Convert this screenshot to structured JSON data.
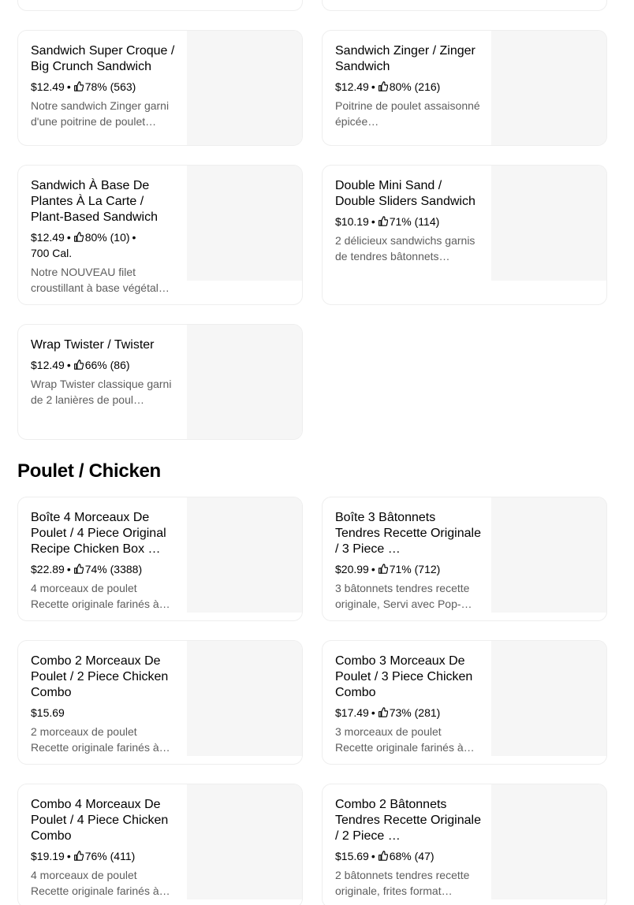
{
  "sections": {
    "chicken_title": "Poulet / Chicken"
  },
  "items": [
    {
      "title": "Sandwich Super Croque / Big Crunch Sandwich",
      "price": "$12.49",
      "rating": "78% (563)",
      "calories": "",
      "description": "Notre sandwich Zinger garni d'une poitrine de poulet…"
    },
    {
      "title": "Sandwich Zinger / Zinger Sandwich",
      "price": "$12.49",
      "rating": "80% (216)",
      "calories": "",
      "description": "Poitrine de poulet assaisonné épicée…"
    },
    {
      "title": "Sandwich À Base De Plantes À La Carte / Plant-Based Sandwich",
      "price": "$12.49",
      "rating": "80% (10)",
      "calories": "700 Cal.",
      "description": "Notre NOUVEAU filet croustillant à base végétal…"
    },
    {
      "title": "Double Mini Sand / Double Sliders Sandwich",
      "price": "$10.19",
      "rating": "71% (114)",
      "calories": "",
      "description": "2 délicieux sandwichs garnis de tendres bâtonnets…"
    },
    {
      "title": "Wrap Twister / Twister",
      "price": "$12.49",
      "rating": "66% (86)",
      "calories": "",
      "description": "Wrap Twister classique garni de 2 lanières de poul…"
    },
    {
      "title": "Boîte 4 Morceaux De Poulet / 4 Piece Original Recipe Chicken Box …",
      "price": "$22.89",
      "rating": "74% (3388)",
      "calories": "",
      "description": "4 morceaux de poulet Recette originale farinés à…"
    },
    {
      "title": "Boîte 3 Bâtonnets Tendres Recette Originale / 3 Piece …",
      "price": "$20.99",
      "rating": "71% (712)",
      "calories": "",
      "description": "3 bâtonnets tendres recette originale, Servi avec Pop-…"
    },
    {
      "title": "Combo 2 Morceaux De Poulet / 2 Piece Chicken Combo",
      "price": "$15.69",
      "rating": "",
      "calories": "",
      "description": "2 morceaux de poulet Recette originale farinés à…"
    },
    {
      "title": "Combo 3 Morceaux De Poulet / 3 Piece Chicken Combo",
      "price": "$17.49",
      "rating": "73% (281)",
      "calories": "",
      "description": "3 morceaux de poulet Recette originale farinés à…"
    },
    {
      "title": "Combo 4 Morceaux De Poulet / 4 Piece Chicken Combo",
      "price": "$19.19",
      "rating": "76% (411)",
      "calories": "",
      "description": "4 morceaux de poulet Recette originale farinés à…"
    },
    {
      "title": "Combo 2 Bâtonnets Tendres Recette Originale / 2 Piece …",
      "price": "$15.69",
      "rating": "68% (47)",
      "calories": "",
      "description": "2 bâtonnets tendres recette originale, frites format…"
    }
  ],
  "icons": {
    "rating": "thumbs-up-icon"
  },
  "colors": {
    "text": "#000000",
    "muted": "#5e5e5e",
    "border": "#eeeeee",
    "image_placeholder": "#f6f6f6"
  }
}
